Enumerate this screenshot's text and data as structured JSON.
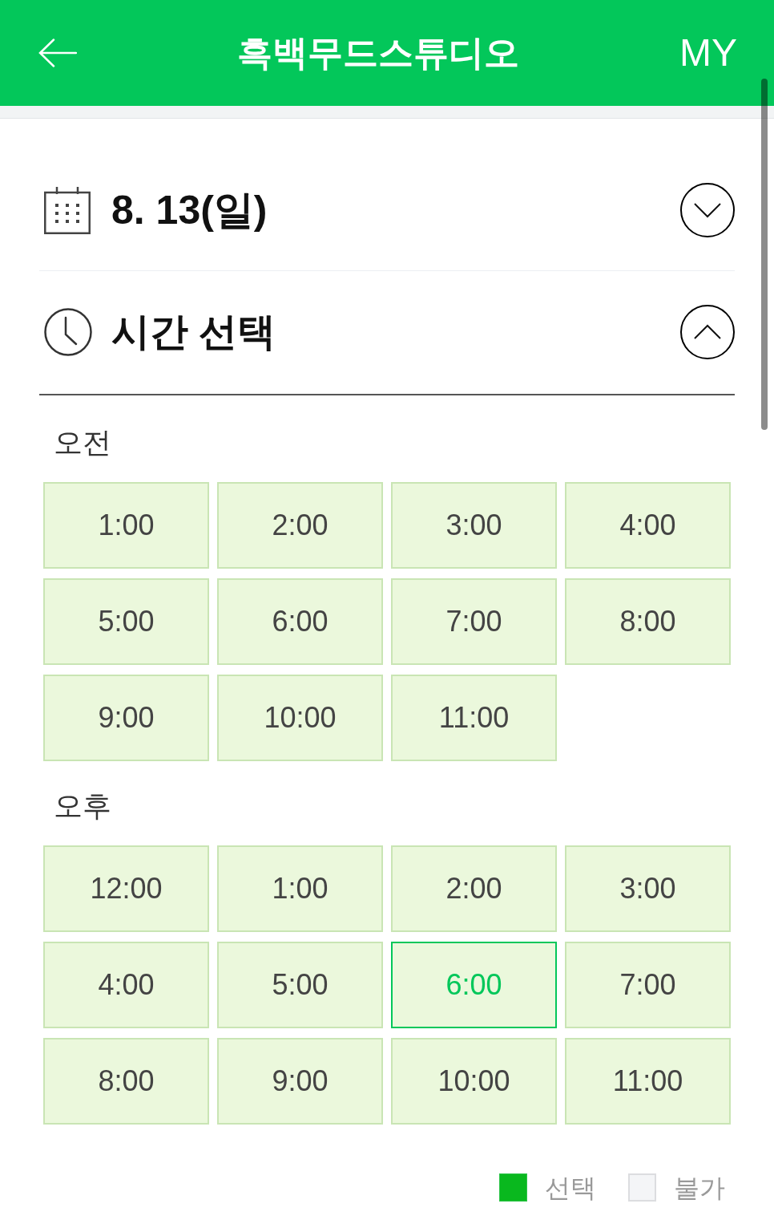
{
  "header": {
    "title": "흑백무드스튜디오",
    "my_link": "MY"
  },
  "date_section": {
    "date": "8. 13(일)",
    "expanded": false
  },
  "time_section": {
    "title": "시간 선택",
    "expanded": true
  },
  "periods": [
    {
      "label": "오전",
      "slots": [
        {
          "time": "1:00",
          "selected": false
        },
        {
          "time": "2:00",
          "selected": false
        },
        {
          "time": "3:00",
          "selected": false
        },
        {
          "time": "4:00",
          "selected": false
        },
        {
          "time": "5:00",
          "selected": false
        },
        {
          "time": "6:00",
          "selected": false
        },
        {
          "time": "7:00",
          "selected": false
        },
        {
          "time": "8:00",
          "selected": false
        },
        {
          "time": "9:00",
          "selected": false
        },
        {
          "time": "10:00",
          "selected": false
        },
        {
          "time": "11:00",
          "selected": false
        }
      ]
    },
    {
      "label": "오후",
      "slots": [
        {
          "time": "12:00",
          "selected": false
        },
        {
          "time": "1:00",
          "selected": false
        },
        {
          "time": "2:00",
          "selected": false
        },
        {
          "time": "3:00",
          "selected": false
        },
        {
          "time": "4:00",
          "selected": false
        },
        {
          "time": "5:00",
          "selected": false
        },
        {
          "time": "6:00",
          "selected": true
        },
        {
          "time": "7:00",
          "selected": false
        },
        {
          "time": "8:00",
          "selected": false
        },
        {
          "time": "9:00",
          "selected": false
        },
        {
          "time": "10:00",
          "selected": false
        },
        {
          "time": "11:00",
          "selected": false
        }
      ]
    }
  ],
  "legend": [
    {
      "kind": "selected",
      "label": "선택"
    },
    {
      "kind": "unavailable",
      "label": "불가"
    }
  ]
}
